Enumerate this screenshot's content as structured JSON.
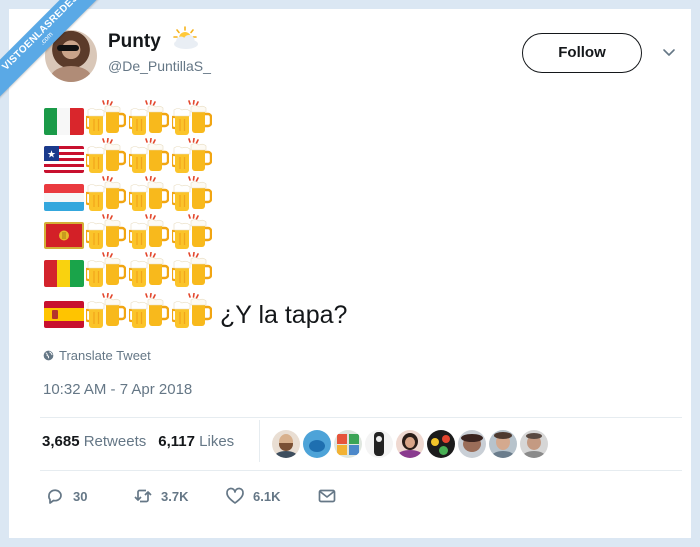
{
  "watermark": {
    "line1": "VISTOENLASREDES",
    "line2": ".com"
  },
  "user": {
    "display_name": "Punty",
    "handle": "@De_PuntillaS_"
  },
  "follow_button": {
    "label": "Follow"
  },
  "tweet": {
    "rows": [
      {
        "flag": "italy",
        "beers": 3
      },
      {
        "flag": "liberia",
        "beers": 3
      },
      {
        "flag": "luxembourg",
        "beers": 3
      },
      {
        "flag": "montenegro",
        "beers": 3
      },
      {
        "flag": "guinea",
        "beers": 3
      },
      {
        "flag": "spain",
        "beers": 3
      }
    ],
    "text": "¿Y la tapa?",
    "translate_label": "Translate Tweet",
    "timestamp": "10:32 AM - 7 Apr 2018"
  },
  "stats": {
    "retweets_count": "3,685",
    "retweets_label": "Retweets",
    "likes_count": "6,117",
    "likes_label": "Likes"
  },
  "actions": {
    "reply_count": "30",
    "retweet_count": "3.7K",
    "like_count": "6.1K"
  },
  "colors": {
    "frame": "#dbe7f3",
    "ribbon": "#5aa9e6",
    "secondary_text": "#657786",
    "divider": "#e6ecf0"
  }
}
